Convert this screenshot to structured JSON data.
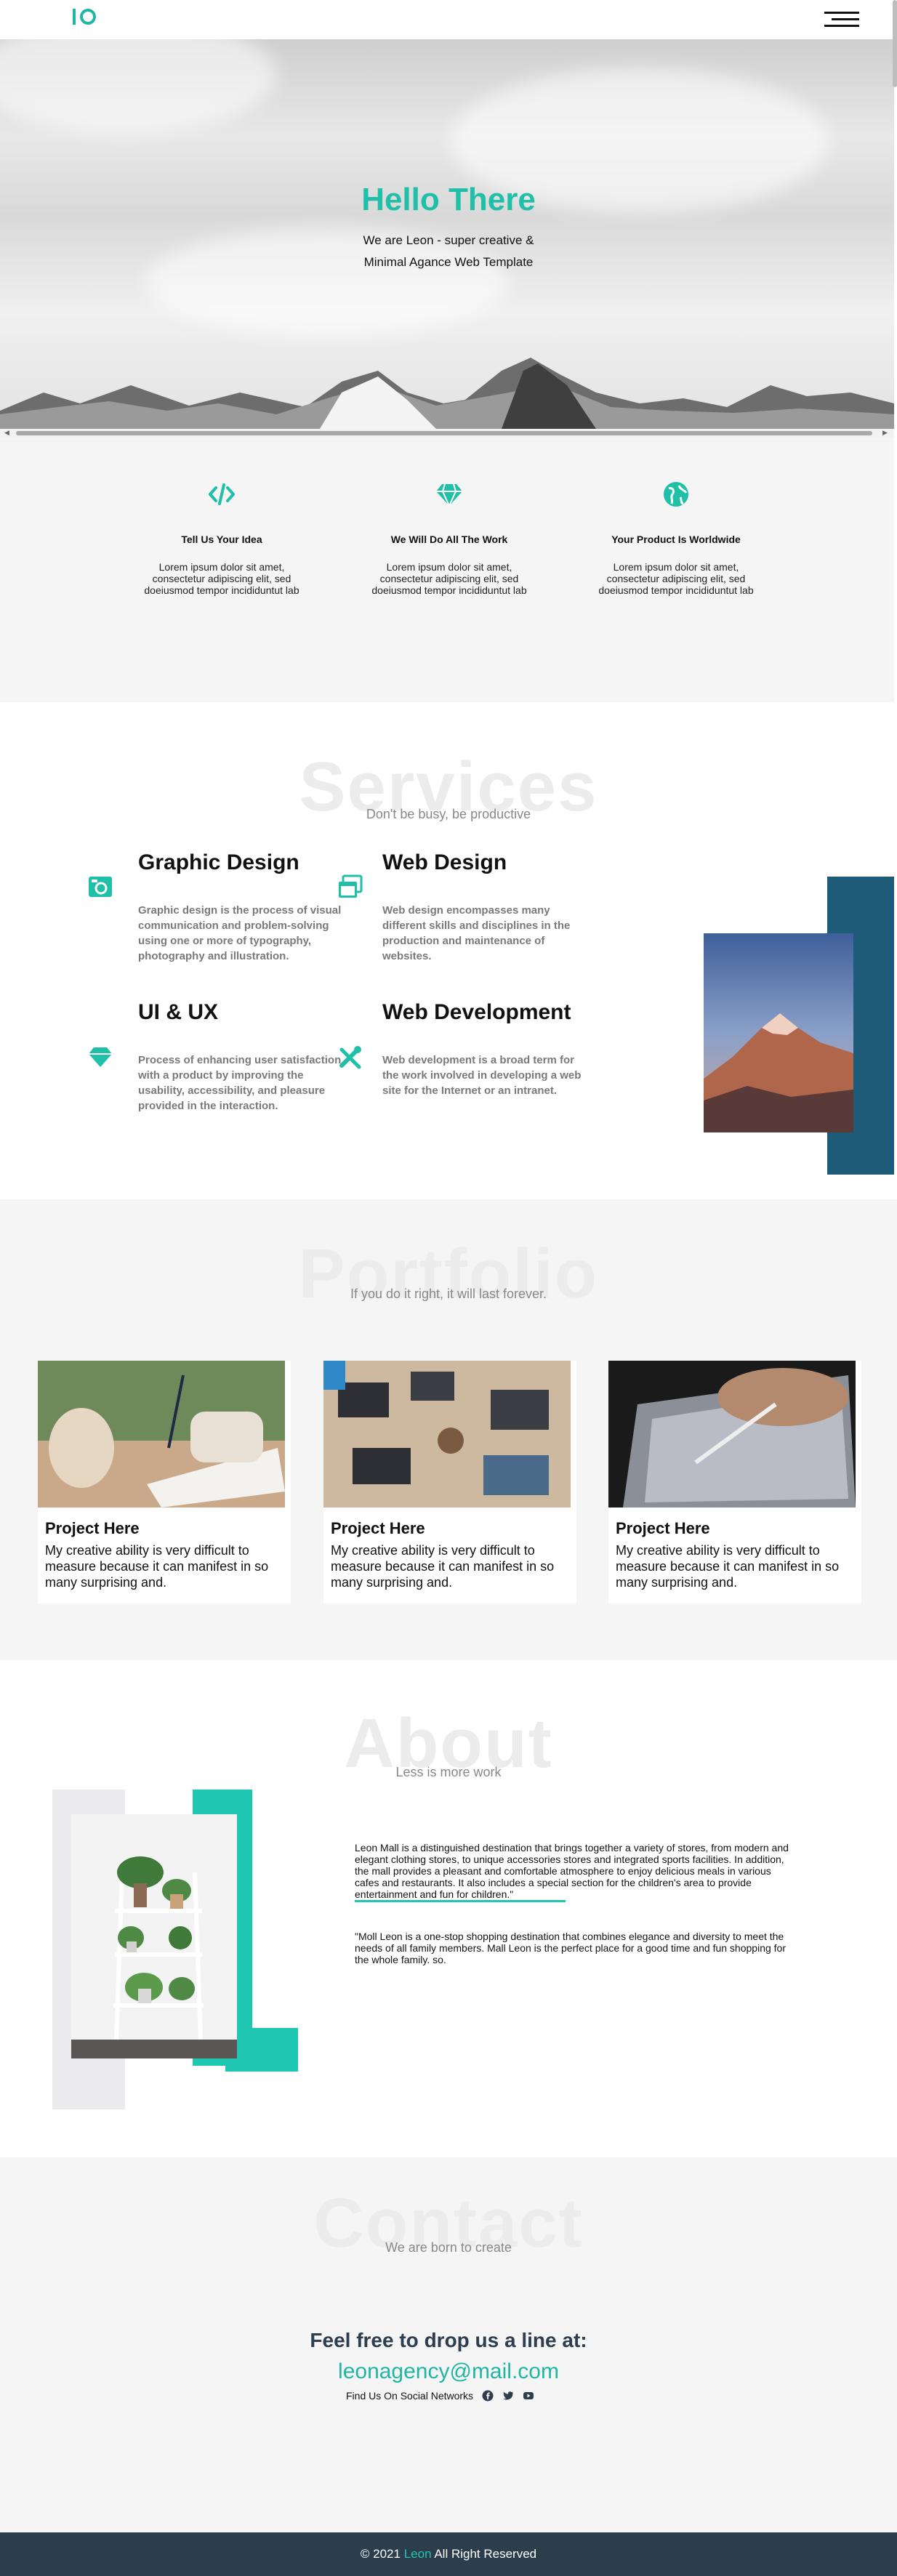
{
  "colors": {
    "accent": "#1fb7a4",
    "dark_teal": "#1d5b78",
    "footer_bg": "#2c3e4c",
    "section_bg": "#f5f5f5"
  },
  "header": {
    "logo_icon": "io-logo-icon",
    "menu_icon": "hamburger-menu-icon"
  },
  "hero": {
    "title": "Hello There",
    "subtitle_line1": "We are Leon - super creative &",
    "subtitle_line2": "Minimal Agance Web Template"
  },
  "features": [
    {
      "icon": "code-icon",
      "title": "Tell Us Your Idea",
      "text": "Lorem ipsum dolor sit amet, consectetur adipiscing elit, sed doeiusmod tempor incididuntut lab"
    },
    {
      "icon": "diamond-icon",
      "title": "We Will Do All The Work",
      "text": "Lorem ipsum dolor sit amet, consectetur adipiscing elit, sed doeiusmod tempor incididuntut lab"
    },
    {
      "icon": "globe-icon",
      "title": "Your Product Is Worldwide",
      "text": "Lorem ipsum dolor sit amet, consectetur adipiscing elit, sed doeiusmod tempor incididuntut lab"
    }
  ],
  "services": {
    "ghost_title": "Services",
    "subtitle": "Don't be busy, be productive",
    "items": [
      {
        "icon": "camera-icon",
        "title": "Graphic Design",
        "text": "Graphic design is the process of visual communication and problem-solving using one or more of typography, photography and illustration."
      },
      {
        "icon": "windows-icon",
        "title": "Web Design",
        "text": "Web design encompasses many different skills and disciplines in the production and maintenance of websites."
      },
      {
        "icon": "diamond-icon",
        "title": "UI & UX",
        "text": "Process of enhancing user satisfaction with a product by improving the usability, accessibility, and pleasure provided in the interaction."
      },
      {
        "icon": "tools-icon",
        "title": "Web Development",
        "text": "Web development is a broad term for the work involved in developing a web site for the Internet or an intranet."
      }
    ]
  },
  "portfolio": {
    "ghost_title": "Portfolio",
    "subtitle": "If you do it right, it will last forever.",
    "projects": [
      {
        "title": "Project Here",
        "text": "My creative ability is very difficult to measure because it can manifest in so many surprising and."
      },
      {
        "title": "Project Here",
        "text": "My creative ability is very difficult to measure because it can manifest in so many surprising and."
      },
      {
        "title": "Project Here",
        "text": "My creative ability is very difficult to measure because it can manifest in so many surprising and."
      }
    ]
  },
  "about": {
    "ghost_title": "About",
    "subtitle": "Less is more work",
    "paragraph1": "Leon Mall is a distinguished destination that brings together a variety of stores, from modern and elegant clothing stores, to unique accessories stores and integrated sports facilities. In addition, the mall provides a pleasant and comfortable atmosphere to enjoy delicious meals in various cafes and restaurants. It also includes a special section for the children's area to provide entertainment and fun for children.\"",
    "paragraph2": "\"Moll Leon is a one-stop shopping destination that combines elegance and diversity to meet the needs of all family members. Mall Leon is the perfect place for a good time and fun shopping for the whole family. so."
  },
  "contact": {
    "ghost_title": "Contact",
    "subtitle": "We are born to create",
    "cta": "Feel free to drop us a line at:",
    "email": "leonagency@mail.com",
    "social_label": "Find Us On Social Networks",
    "social_icons": [
      "facebook-icon",
      "twitter-icon",
      "youtube-icon"
    ]
  },
  "footer": {
    "prefix": "© 2021",
    "brand": "Leon",
    "suffix": "All Right Reserved"
  }
}
